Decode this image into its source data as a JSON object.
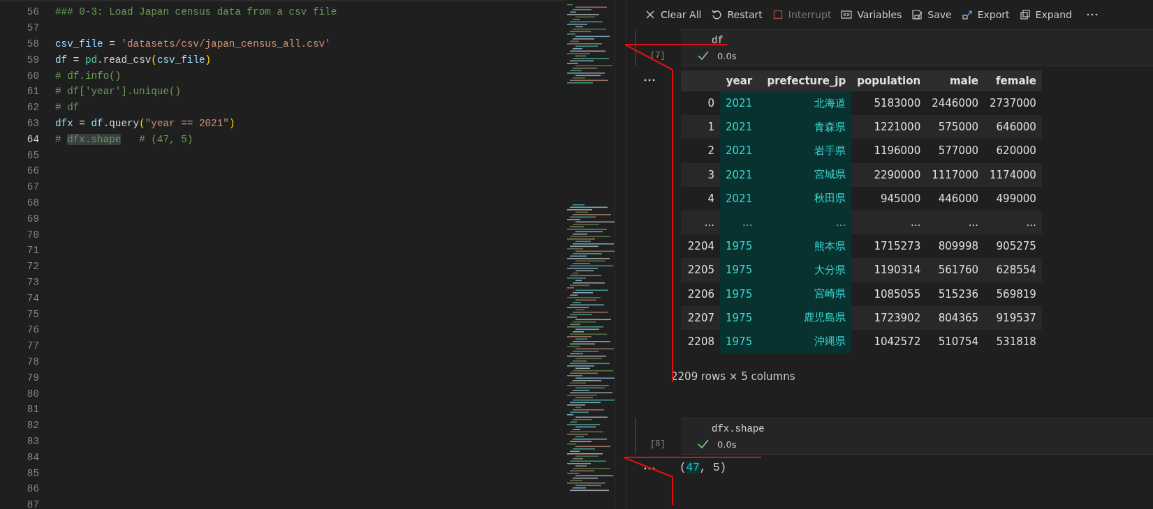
{
  "editor": {
    "lines": [
      {
        "number": "56",
        "current": false,
        "tokens": [
          {
            "text": "### 0-3: Load Japan census data from a csv file",
            "kind": "comment",
            "highlighted": false
          }
        ]
      },
      {
        "number": "57",
        "current": false
      },
      {
        "number": "58",
        "current": false,
        "tokens": [
          {
            "text": "csv_file",
            "kind": "var",
            "highlighted": false
          },
          {
            "text": " = ",
            "kind": "plain",
            "highlighted": false
          },
          {
            "text": "'datasets/csv/japan_census_all.csv'",
            "kind": "string",
            "highlighted": false
          }
        ]
      },
      {
        "number": "59",
        "current": false,
        "tokens": [
          {
            "text": "df",
            "kind": "var",
            "highlighted": false
          },
          {
            "text": " = ",
            "kind": "plain",
            "highlighted": false
          },
          {
            "text": "pd",
            "kind": "module",
            "highlighted": false
          },
          {
            "text": ".read_csv",
            "kind": "plain",
            "highlighted": false
          },
          {
            "text": "(",
            "kind": "paren",
            "highlighted": false
          },
          {
            "text": "csv_file",
            "kind": "var",
            "highlighted": false
          },
          {
            "text": ")",
            "kind": "paren",
            "highlighted": false
          }
        ]
      },
      {
        "number": "60",
        "current": false,
        "tokens": [
          {
            "text": "# df.info()",
            "kind": "comment",
            "highlighted": false
          }
        ]
      },
      {
        "number": "61",
        "current": false,
        "tokens": [
          {
            "text": "# df['year'].unique()",
            "kind": "comment",
            "highlighted": false
          }
        ]
      },
      {
        "number": "62",
        "current": false,
        "tokens": [
          {
            "text": "# df",
            "kind": "comment",
            "highlighted": false
          }
        ]
      },
      {
        "number": "63",
        "current": false,
        "tokens": [
          {
            "text": "dfx",
            "kind": "var",
            "highlighted": false
          },
          {
            "text": " = ",
            "kind": "plain",
            "highlighted": false
          },
          {
            "text": "df",
            "kind": "var",
            "highlighted": false
          },
          {
            "text": ".query",
            "kind": "plain",
            "highlighted": false
          },
          {
            "text": "(",
            "kind": "paren",
            "highlighted": false
          },
          {
            "text": "\"year == 2021\"",
            "kind": "string",
            "highlighted": false
          },
          {
            "text": ")",
            "kind": "paren",
            "highlighted": false
          }
        ]
      },
      {
        "number": "64",
        "current": true,
        "tokens": [
          {
            "text": "# ",
            "kind": "comment",
            "highlighted": false
          },
          {
            "text": "dfx.shape",
            "kind": "comment",
            "highlighted": true
          },
          {
            "text": "   # (47, 5)",
            "kind": "comment",
            "highlighted": false
          }
        ]
      },
      {
        "number": "65",
        "current": false
      },
      {
        "number": "66",
        "current": false
      },
      {
        "number": "67",
        "current": false
      },
      {
        "number": "68",
        "current": false
      },
      {
        "number": "69",
        "current": false
      },
      {
        "number": "70",
        "current": false
      },
      {
        "number": "71",
        "current": false
      },
      {
        "number": "72",
        "current": false
      },
      {
        "number": "73",
        "current": false
      },
      {
        "number": "74",
        "current": false
      },
      {
        "number": "75",
        "current": false
      },
      {
        "number": "76",
        "current": false
      },
      {
        "number": "77",
        "current": false
      },
      {
        "number": "78",
        "current": false
      },
      {
        "number": "79",
        "current": false
      },
      {
        "number": "80",
        "current": false
      },
      {
        "number": "81",
        "current": false
      },
      {
        "number": "82",
        "current": false
      },
      {
        "number": "83",
        "current": false
      },
      {
        "number": "84",
        "current": false
      },
      {
        "number": "85",
        "current": false
      },
      {
        "number": "86",
        "current": false
      },
      {
        "number": "87",
        "current": false
      }
    ]
  },
  "toolbar": [
    {
      "label": "Clear All",
      "disabled": false
    },
    {
      "label": "Restart",
      "disabled": false
    },
    {
      "label": "Interrupt",
      "disabled": true
    },
    {
      "label": "Variables",
      "disabled": false
    },
    {
      "label": "Save",
      "disabled": false
    },
    {
      "label": "Export",
      "disabled": false
    },
    {
      "label": "Expand",
      "disabled": false
    }
  ],
  "cells": [
    {
      "code": "df",
      "execution_count": "[7]",
      "duration": "0.0s",
      "output": {
        "kind": "table",
        "columns": [
          {
            "highlighted": false
          },
          {
            "label": "year",
            "highlighted": true
          },
          {
            "label": "prefecture_jp",
            "highlighted": true
          },
          {
            "label": "population",
            "highlighted": false
          },
          {
            "label": "male",
            "highlighted": false
          },
          {
            "label": "female",
            "highlighted": false
          }
        ],
        "rows": [
          [
            "0",
            "2021",
            "北海道",
            "5183000",
            "2446000",
            "2737000"
          ],
          [
            "1",
            "2021",
            "青森県",
            "1221000",
            "575000",
            "646000"
          ],
          [
            "2",
            "2021",
            "岩手県",
            "1196000",
            "577000",
            "620000"
          ],
          [
            "3",
            "2021",
            "宮城県",
            "2290000",
            "1117000",
            "1174000"
          ],
          [
            "4",
            "2021",
            "秋田県",
            "945000",
            "446000",
            "499000"
          ],
          [
            "...",
            "...",
            "...",
            "...",
            "...",
            "..."
          ],
          [
            "2204",
            "1975",
            "熊本県",
            "1715273",
            "809998",
            "905275"
          ],
          [
            "2205",
            "1975",
            "大分県",
            "1190314",
            "561760",
            "628554"
          ],
          [
            "2206",
            "1975",
            "宮崎県",
            "1085055",
            "515236",
            "569819"
          ],
          [
            "2207",
            "1975",
            "鹿児島県",
            "1723902",
            "804365",
            "919537"
          ],
          [
            "2208",
            "1975",
            "沖縄県",
            "1042572",
            "510754",
            "531818"
          ]
        ],
        "footer": "2209 rows × 5 columns"
      }
    },
    {
      "code": "dfx.shape",
      "execution_count": "[8]",
      "duration": "0.0s",
      "output": {
        "kind": "text",
        "parts": [
          {
            "text": "(",
            "highlighted": false
          },
          {
            "text": "47",
            "highlighted": true
          },
          {
            "text": ", 5)",
            "highlighted": false
          }
        ]
      }
    }
  ]
}
